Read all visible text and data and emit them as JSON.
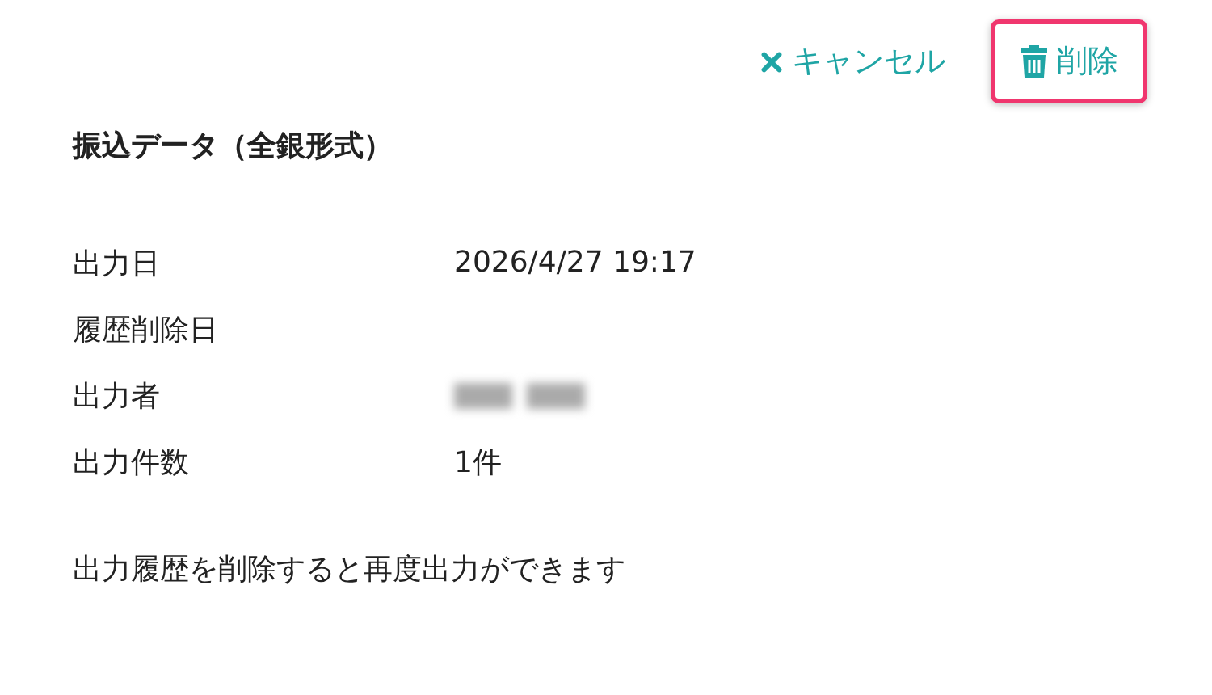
{
  "actions": [
    {
      "kind": "cancel",
      "label": "キャンセル",
      "highlighted": false
    },
    {
      "kind": "delete",
      "label": "削除",
      "highlighted": true
    }
  ],
  "title": "振込データ（全銀形式）",
  "fields": [
    {
      "label": "出力日",
      "value": "2026/4/27 19:17"
    },
    {
      "label": "履歴削除日"
    },
    {
      "label": "出力者",
      "redacted": true
    },
    {
      "label": "出力件数",
      "value": "1件"
    }
  ],
  "note": "出力履歴を削除すると再度出力ができます"
}
